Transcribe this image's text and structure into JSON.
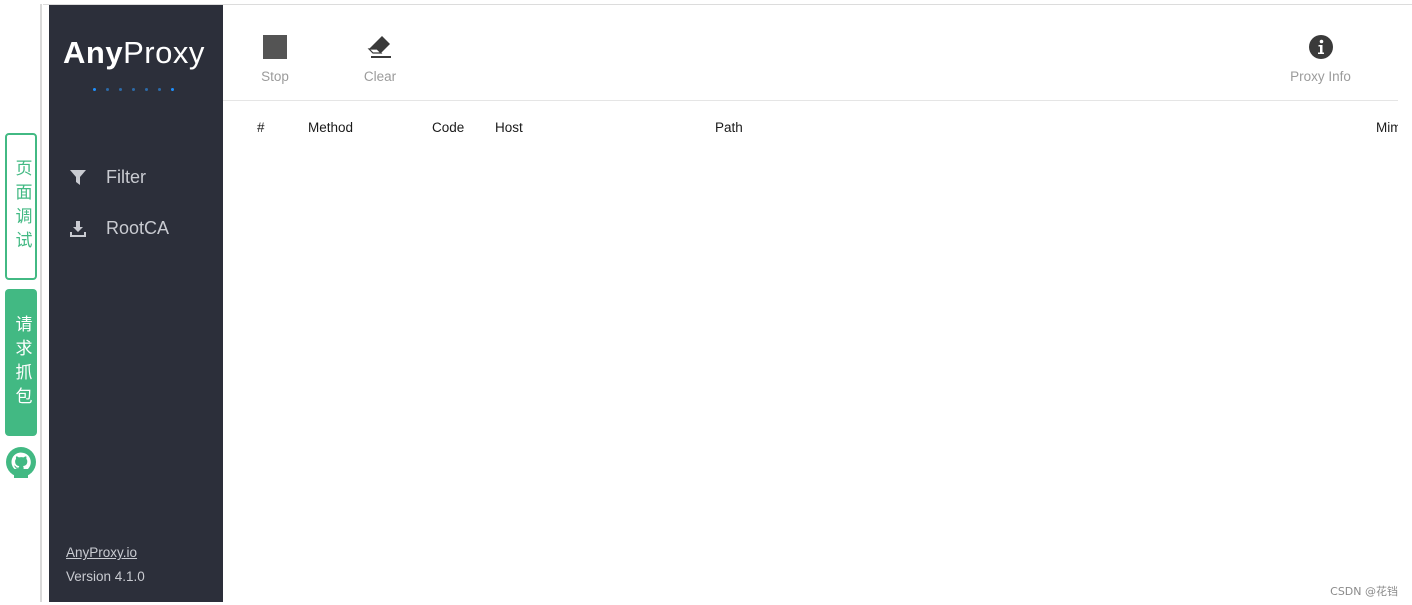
{
  "rail": {
    "tab_debug": "页面调试",
    "tab_capture": "请求抓包",
    "accent_color": "#42b983",
    "github_icon": "github-icon"
  },
  "sidebar": {
    "logo_bold": "Any",
    "logo_light": "Proxy",
    "items": [
      {
        "label": "Filter",
        "icon": "filter-icon"
      },
      {
        "label": "RootCA",
        "icon": "download-icon"
      }
    ],
    "link": "AnyProxy.io",
    "version": "Version 4.1.0",
    "background": "#2c2f3a"
  },
  "toolbar": {
    "stop_label": "Stop",
    "clear_label": "Clear",
    "info_label": "Proxy Info"
  },
  "table": {
    "columns": [
      "#",
      "Method",
      "Code",
      "Host",
      "Path",
      "Mime"
    ]
  },
  "watermark": "CSDN @花铛"
}
